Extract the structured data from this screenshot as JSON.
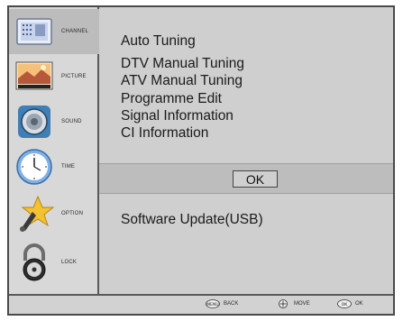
{
  "sidebar": {
    "items": [
      {
        "label": "CHANNEL",
        "icon": "channel-icon",
        "active": true
      },
      {
        "label": "PICTURE",
        "icon": "picture-icon"
      },
      {
        "label": "SOUND",
        "icon": "speaker-icon"
      },
      {
        "label": "TIME",
        "icon": "clock-icon"
      },
      {
        "label": "OPTION",
        "icon": "star-wrench-icon"
      },
      {
        "label": "LOCK",
        "icon": "padlock-icon"
      }
    ]
  },
  "menu": {
    "items": [
      "Auto Tuning",
      "DTV Manual Tuning",
      "ATV Manual Tuning",
      "Programme Edit",
      "Signal Information",
      "CI Information"
    ],
    "ok_label": "OK",
    "software_update": "Software Update(USB)"
  },
  "bottom_bar": {
    "hints": [
      {
        "key": "MENU",
        "label": "BACK"
      },
      {
        "key": "",
        "label": "MOVE"
      },
      {
        "key": "OK",
        "label": "OK"
      }
    ]
  },
  "colors": {
    "panel": "#cfcfcf",
    "sidebar": "#d8d8d8",
    "highlight": "#bdbdbd",
    "border": "#4a4a4a"
  }
}
